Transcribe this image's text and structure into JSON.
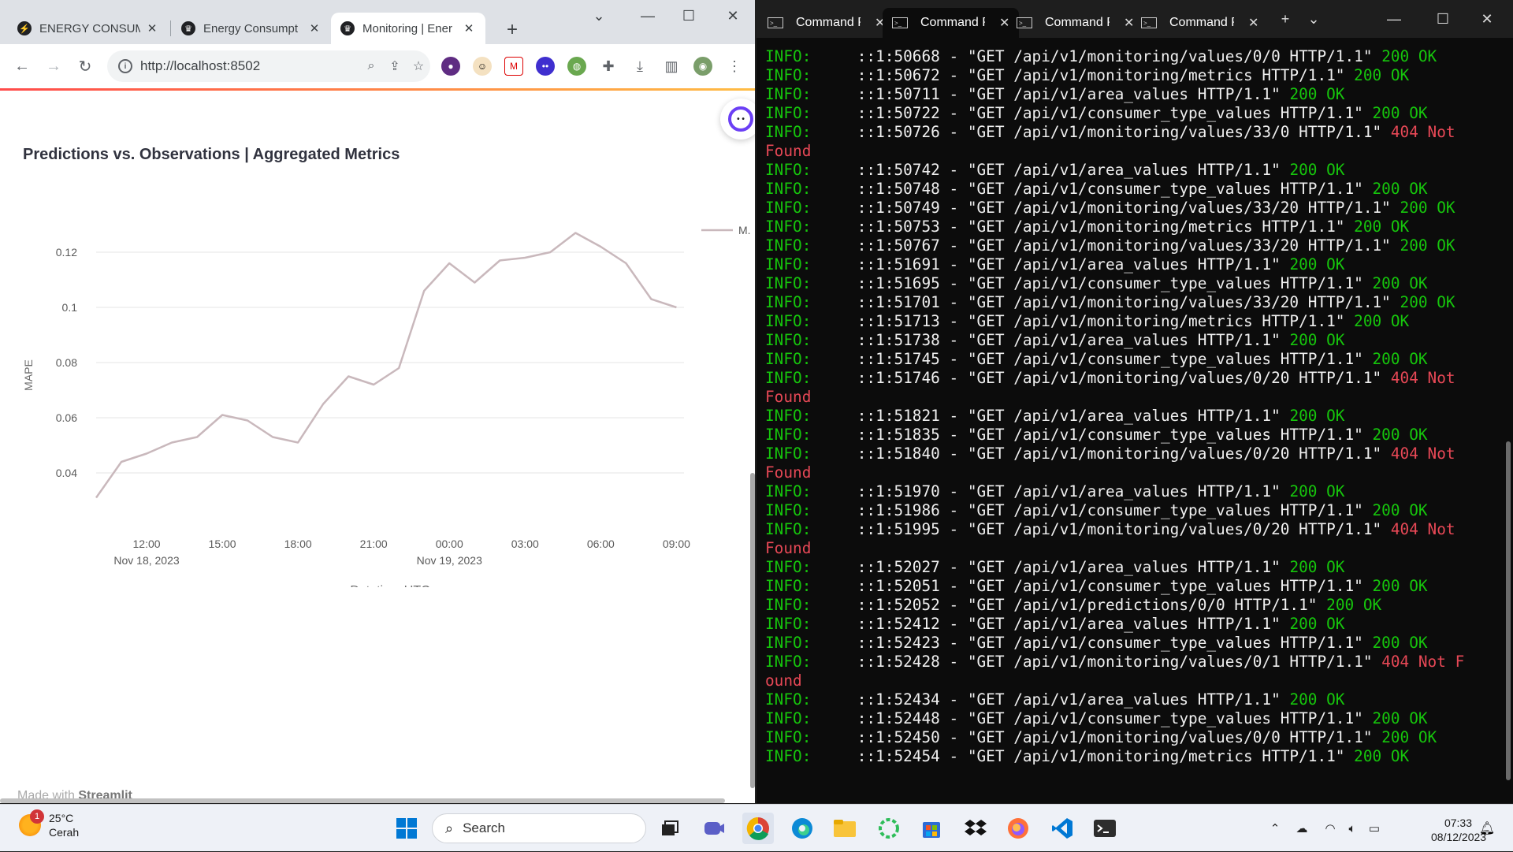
{
  "browser": {
    "tabs": [
      {
        "title": "ENERGY CONSUM",
        "icon": "lightning-icon"
      },
      {
        "title": "Energy Consumpt",
        "icon": "streamlit-icon"
      },
      {
        "title": "Monitoring | Ener",
        "icon": "streamlit-icon"
      }
    ],
    "active_tab": 2,
    "url": "http://localhost:8502"
  },
  "page": {
    "title": "Predictions vs. Observations | Aggregated Metrics",
    "footer_prefix": "Made with",
    "footer_brand": "Streamlit"
  },
  "chart_data": {
    "type": "line",
    "title": "Predictions vs. Observations | Aggregated Metrics",
    "xlabel": "Datetime UTC",
    "ylabel": "MAPE",
    "legend": [
      "M."
    ],
    "legend_position": "top-right",
    "grid": true,
    "color": "#c9b8bc",
    "ylim": [
      0.03,
      0.13
    ],
    "x_ticks": [
      {
        "label": "12:00",
        "sub": "Nov 18, 2023",
        "hours": 12
      },
      {
        "label": "15:00",
        "sub": "",
        "hours": 15
      },
      {
        "label": "18:00",
        "sub": "",
        "hours": 18
      },
      {
        "label": "21:00",
        "sub": "",
        "hours": 21
      },
      {
        "label": "00:00",
        "sub": "Nov 19, 2023",
        "hours": 24
      },
      {
        "label": "03:00",
        "sub": "",
        "hours": 27
      },
      {
        "label": "06:00",
        "sub": "",
        "hours": 30
      },
      {
        "label": "09:00",
        "sub": "",
        "hours": 33
      }
    ],
    "y_ticks": [
      0.04,
      0.06,
      0.08,
      0.1,
      0.12
    ],
    "series": [
      {
        "x": [
          "2023-11-18 10:00",
          "2023-11-18 11:00",
          "2023-11-18 12:00",
          "2023-11-18 13:00",
          "2023-11-18 14:00",
          "2023-11-18 15:00",
          "2023-11-18 16:00",
          "2023-11-18 17:00",
          "2023-11-18 18:00",
          "2023-11-18 19:00",
          "2023-11-18 20:00",
          "2023-11-18 21:00",
          "2023-11-18 22:00",
          "2023-11-18 23:00",
          "2023-11-19 00:00",
          "2023-11-19 01:00",
          "2023-11-19 02:00",
          "2023-11-19 03:00",
          "2023-11-19 04:00",
          "2023-11-19 05:00",
          "2023-11-19 06:00",
          "2023-11-19 07:00",
          "2023-11-19 08:00",
          "2023-11-19 09:00"
        ],
        "y": [
          0.031,
          0.044,
          0.047,
          0.051,
          0.053,
          0.061,
          0.059,
          0.053,
          0.051,
          0.065,
          0.075,
          0.072,
          0.078,
          0.106,
          0.116,
          0.109,
          0.117,
          0.118,
          0.12,
          0.127,
          0.122,
          0.116,
          0.103,
          0.1
        ]
      }
    ]
  },
  "terminal": {
    "tabs": [
      "Command Prompt",
      "Command Prompt",
      "Command Prompt",
      "Command Prompt"
    ],
    "active_tab": 1,
    "lines": [
      {
        "a": "INFO:     ::1:50668 - \"GET /api/v1/monitoring/values/0/0 HTTP/1.1\" ",
        "b": "200 OK",
        "c": "g"
      },
      {
        "a": "INFO:     ::1:50672 - \"GET /api/v1/monitoring/metrics HTTP/1.1\" ",
        "b": "200 OK",
        "c": "g"
      },
      {
        "a": "INFO:     ::1:50711 - \"GET /api/v1/area_values HTTP/1.1\" ",
        "b": "200 OK",
        "c": "g"
      },
      {
        "a": "INFO:     ::1:50722 - \"GET /api/v1/consumer_type_values HTTP/1.1\" ",
        "b": "200 OK",
        "c": "g"
      },
      {
        "a": "INFO:     ::1:50726 - \"GET /api/v1/monitoring/values/33/0 HTTP/1.1\" ",
        "b": "404 Not",
        "c": "r"
      },
      {
        "a": "",
        "b": "Found",
        "c": "r"
      },
      {
        "a": "INFO:     ::1:50742 - \"GET /api/v1/area_values HTTP/1.1\" ",
        "b": "200 OK",
        "c": "g"
      },
      {
        "a": "INFO:     ::1:50748 - \"GET /api/v1/consumer_type_values HTTP/1.1\" ",
        "b": "200 OK",
        "c": "g"
      },
      {
        "a": "INFO:     ::1:50749 - \"GET /api/v1/monitoring/values/33/20 HTTP/1.1\" ",
        "b": "200 OK",
        "c": "g"
      },
      {
        "a": "INFO:     ::1:50753 - \"GET /api/v1/monitoring/metrics HTTP/1.1\" ",
        "b": "200 OK",
        "c": "g"
      },
      {
        "a": "INFO:     ::1:50767 - \"GET /api/v1/monitoring/values/33/20 HTTP/1.1\" ",
        "b": "200 OK",
        "c": "g"
      },
      {
        "a": "INFO:     ::1:51691 - \"GET /api/v1/area_values HTTP/1.1\" ",
        "b": "200 OK",
        "c": "g"
      },
      {
        "a": "INFO:     ::1:51695 - \"GET /api/v1/consumer_type_values HTTP/1.1\" ",
        "b": "200 OK",
        "c": "g"
      },
      {
        "a": "INFO:     ::1:51701 - \"GET /api/v1/monitoring/values/33/20 HTTP/1.1\" ",
        "b": "200 OK",
        "c": "g"
      },
      {
        "a": "INFO:     ::1:51713 - \"GET /api/v1/monitoring/metrics HTTP/1.1\" ",
        "b": "200 OK",
        "c": "g"
      },
      {
        "a": "INFO:     ::1:51738 - \"GET /api/v1/area_values HTTP/1.1\" ",
        "b": "200 OK",
        "c": "g"
      },
      {
        "a": "INFO:     ::1:51745 - \"GET /api/v1/consumer_type_values HTTP/1.1\" ",
        "b": "200 OK",
        "c": "g"
      },
      {
        "a": "INFO:     ::1:51746 - \"GET /api/v1/monitoring/values/0/20 HTTP/1.1\" ",
        "b": "404 Not",
        "c": "r"
      },
      {
        "a": "",
        "b": "Found",
        "c": "r"
      },
      {
        "a": "INFO:     ::1:51821 - \"GET /api/v1/area_values HTTP/1.1\" ",
        "b": "200 OK",
        "c": "g"
      },
      {
        "a": "INFO:     ::1:51835 - \"GET /api/v1/consumer_type_values HTTP/1.1\" ",
        "b": "200 OK",
        "c": "g"
      },
      {
        "a": "INFO:     ::1:51840 - \"GET /api/v1/monitoring/values/0/20 HTTP/1.1\" ",
        "b": "404 Not",
        "c": "r"
      },
      {
        "a": "",
        "b": "Found",
        "c": "r"
      },
      {
        "a": "INFO:     ::1:51970 - \"GET /api/v1/area_values HTTP/1.1\" ",
        "b": "200 OK",
        "c": "g"
      },
      {
        "a": "INFO:     ::1:51986 - \"GET /api/v1/consumer_type_values HTTP/1.1\" ",
        "b": "200 OK",
        "c": "g"
      },
      {
        "a": "INFO:     ::1:51995 - \"GET /api/v1/monitoring/values/0/20 HTTP/1.1\" ",
        "b": "404 Not",
        "c": "r"
      },
      {
        "a": "",
        "b": "Found",
        "c": "r"
      },
      {
        "a": "INFO:     ::1:52027 - \"GET /api/v1/area_values HTTP/1.1\" ",
        "b": "200 OK",
        "c": "g"
      },
      {
        "a": "INFO:     ::1:52051 - \"GET /api/v1/consumer_type_values HTTP/1.1\" ",
        "b": "200 OK",
        "c": "g"
      },
      {
        "a": "INFO:     ::1:52052 - \"GET /api/v1/predictions/0/0 HTTP/1.1\" ",
        "b": "200 OK",
        "c": "g"
      },
      {
        "a": "INFO:     ::1:52412 - \"GET /api/v1/area_values HTTP/1.1\" ",
        "b": "200 OK",
        "c": "g"
      },
      {
        "a": "INFO:     ::1:52423 - \"GET /api/v1/consumer_type_values HTTP/1.1\" ",
        "b": "200 OK",
        "c": "g"
      },
      {
        "a": "INFO:     ::1:52428 - \"GET /api/v1/monitoring/values/0/1 HTTP/1.1\" ",
        "b": "404 Not F",
        "c": "r"
      },
      {
        "a": "",
        "b": "ound",
        "c": "r"
      },
      {
        "a": "INFO:     ::1:52434 - \"GET /api/v1/area_values HTTP/1.1\" ",
        "b": "200 OK",
        "c": "g"
      },
      {
        "a": "INFO:     ::1:52448 - \"GET /api/v1/consumer_type_values HTTP/1.1\" ",
        "b": "200 OK",
        "c": "g"
      },
      {
        "a": "INFO:     ::1:52450 - \"GET /api/v1/monitoring/values/0/0 HTTP/1.1\" ",
        "b": "200 OK",
        "c": "g"
      },
      {
        "a": "INFO:     ::1:52454 - \"GET /api/v1/monitoring/metrics HTTP/1.1\" ",
        "b": "200 OK",
        "c": "g"
      }
    ]
  },
  "taskbar": {
    "weather_temp": "25°C",
    "weather_desc": "Cerah",
    "weather_badge": "1",
    "search_placeholder": "Search",
    "time": "07:33",
    "date": "08/12/2023"
  }
}
